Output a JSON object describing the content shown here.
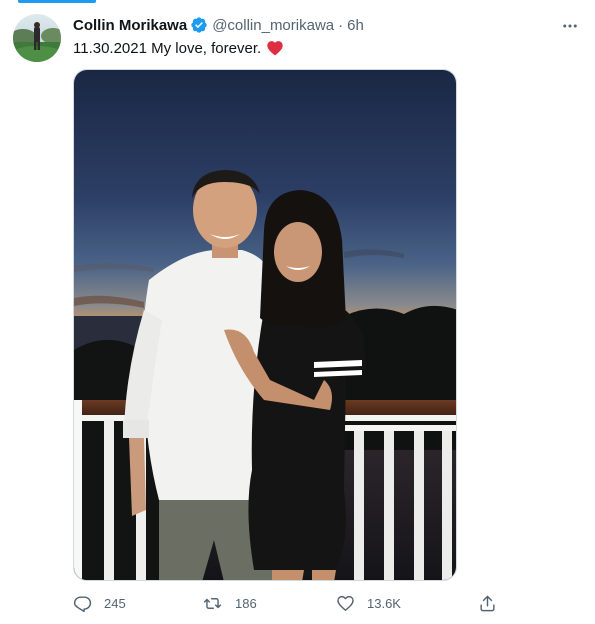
{
  "tweet": {
    "author": {
      "display_name": "Collin Morikawa",
      "handle": "@collin_morikawa",
      "verified": true
    },
    "time": "6h",
    "separator": "·",
    "text": "11.30.2021 My love, forever.",
    "emoji": "red-heart",
    "actions": {
      "reply_count": "245",
      "retweet_count": "186",
      "like_count": "13.6K"
    }
  },
  "colors": {
    "accent": "#1d9bf0",
    "secondary_text": "#536471",
    "heart": "#e0245e"
  }
}
